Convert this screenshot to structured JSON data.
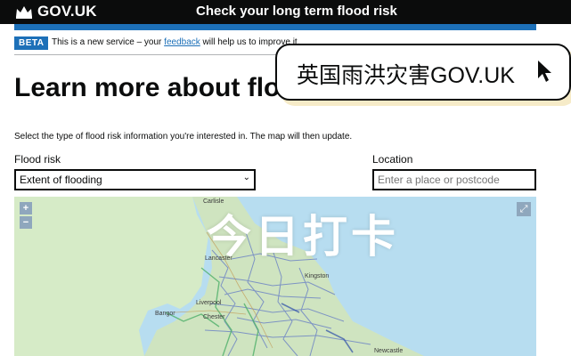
{
  "header": {
    "logo_text": "GOV.UK",
    "service_name": "Check your long term flood risk",
    "crown_icon": "crown-icon"
  },
  "phase_banner": {
    "tag": "BETA",
    "text_before": "This is a new service – your ",
    "link": "feedback",
    "text_after": " will help us to improve it."
  },
  "page": {
    "title": "Learn more about flood risk",
    "intro": "Select the type of flood risk information you're interested in. The map will then update."
  },
  "form": {
    "flood_risk_label": "Flood risk",
    "flood_risk_value": "Extent of flooding",
    "location_label": "Location",
    "location_placeholder": "Enter a place or postcode"
  },
  "map": {
    "zoom_in": "+",
    "zoom_out": "−",
    "expand_icon": "expand-icon",
    "places": [
      "Carlisle",
      "Lancaster",
      "Kingston",
      "Bangor",
      "Chester",
      "Liverpool",
      "Newcastle"
    ]
  },
  "overlays": {
    "callout": "英国雨洪灾害GOV.UK",
    "stamp": "今日打卡",
    "quote": "“"
  },
  "colors": {
    "black": "#0b0c0c",
    "govuk_blue": "#1d70b8",
    "map_water": "#b7ddf0",
    "callout_shadow": "#f6ebc8"
  }
}
